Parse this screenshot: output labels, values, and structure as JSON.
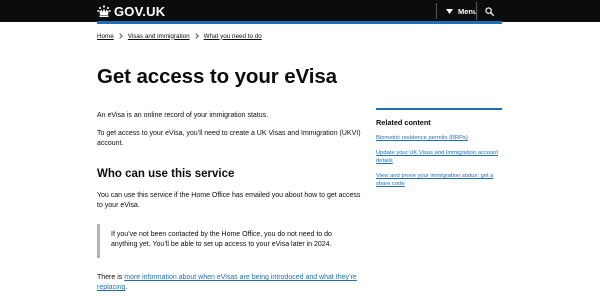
{
  "header": {
    "logo_text": "GOV.UK",
    "menu_label": "Menu",
    "accent_color": "#1d70b8",
    "background_color": "#0b0c0c"
  },
  "breadcrumb": [
    {
      "label": "Home"
    },
    {
      "label": "Visas and immigration"
    },
    {
      "label": "What you need to do"
    }
  ],
  "main": {
    "title": "Get access to your eVisa",
    "intro": "An eVisa is an online record of your immigration status.",
    "instruction": "To get access to your eVisa, you’ll need to create a UK Visas and Immigration (UKVI) account.",
    "section_heading": "Who can use this service",
    "section_text": "You can use this service if the Home Office has emailed you about how to get access to your eVisa.",
    "inset_text": "If you’ve not been contacted by the Home Office, you do not need to do anything yet. You’ll be able to set up access to your eVisa later in 2024.",
    "more_info_prefix": "There is ",
    "more_info_link": "more information about when eVisas are being introduced and what they’re replacing",
    "more_info_suffix": "."
  },
  "related": {
    "title": "Related content",
    "items": [
      {
        "label": "Biometric residence permits (BRPs)"
      },
      {
        "label": "Update your UK Visas and Immigration account details"
      },
      {
        "label": "View and prove your immigration status: get a share code"
      }
    ]
  },
  "icons": {
    "crown": "crown-icon",
    "menu_chevron": "chevron-down-icon",
    "search": "search-icon"
  }
}
